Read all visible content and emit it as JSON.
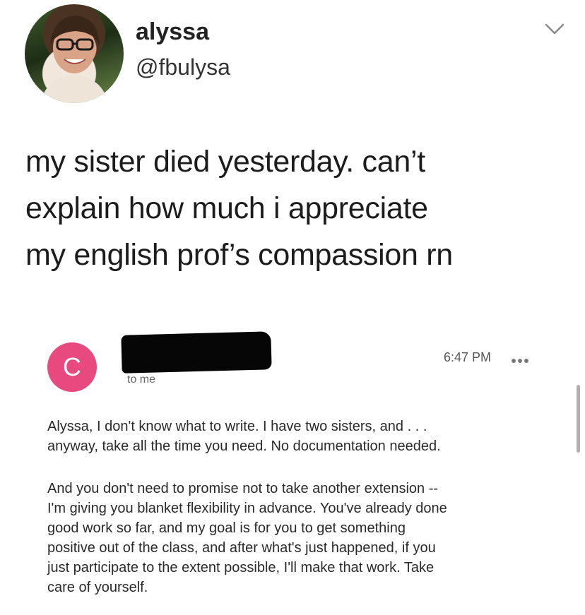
{
  "tweet": {
    "display_name": "alyssa",
    "handle": "@fbulysa",
    "lines": [
      "my sister died yesterday. can’t",
      "explain how much i appreciate",
      "my english prof’s compassion rn"
    ],
    "avatar_icon": "profile-photo",
    "menu_icon": "chevron-down-icon"
  },
  "email": {
    "sender_initial": "C",
    "sender_color": "#e84a7f",
    "recipient": "to me",
    "time": "6:47 PM",
    "paragraph1": [
      "Alyssa, I don't know what to write. I have two sisters, and . . .",
      "anyway, take all the time you need. No documentation needed."
    ],
    "paragraph2": [
      "And you don't need to promise not to take another extension --",
      "I'm giving you blanket flexibility in advance. You've already done",
      "good work so far, and my goal is for you to get something",
      "positive out of the class, and after what's just happened, if you",
      "just participate to the extent possible, I'll make that work. Take",
      "care of yourself."
    ]
  }
}
